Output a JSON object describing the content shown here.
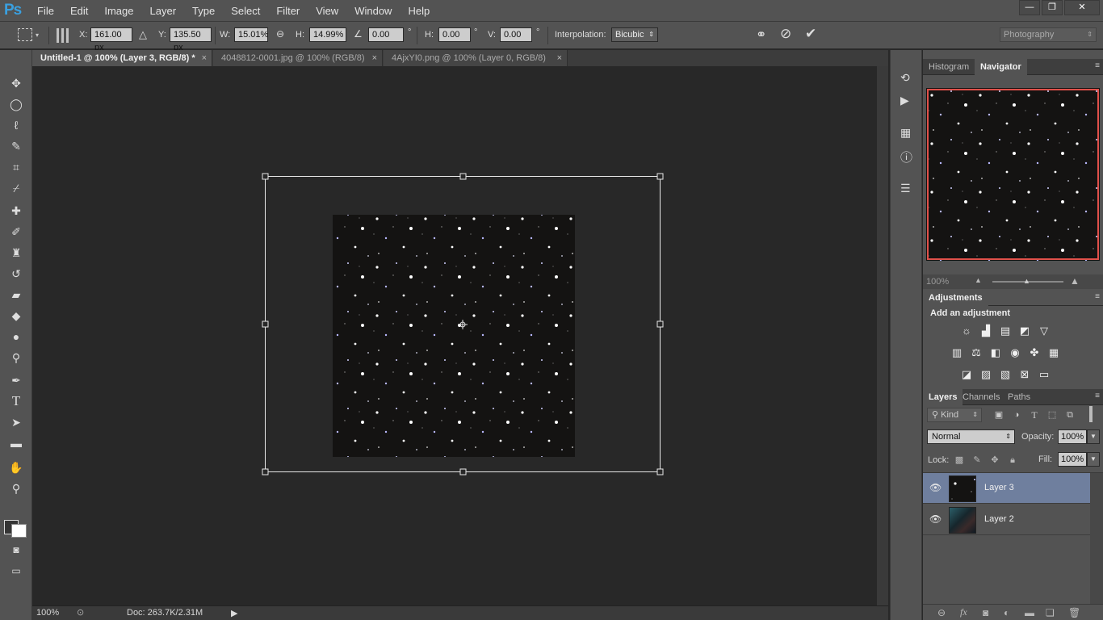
{
  "app": {
    "logo": "Ps"
  },
  "menu": [
    "File",
    "Edit",
    "Image",
    "Layer",
    "Type",
    "Select",
    "Filter",
    "View",
    "Window",
    "Help"
  ],
  "window_controls": {
    "minimize": "—",
    "restore": "❐",
    "close": "✕"
  },
  "options": {
    "x_label": "X:",
    "x_value": "161.00 px",
    "y_label": "Y:",
    "y_value": "135.50 px",
    "w_label": "W:",
    "w_value": "15.01%",
    "h_label": "H:",
    "h_value": "14.99%",
    "angle_value": "0.00",
    "angle_unit": "°",
    "hskew_label": "H:",
    "hskew_value": "0.00",
    "hskew_unit": "°",
    "vskew_label": "V:",
    "vskew_value": "0.00",
    "vskew_unit": "°",
    "interp_label": "Interpolation:",
    "interp_value": "Bicubic",
    "workspace": "Photography"
  },
  "doc_tabs": [
    {
      "label": "Untitled-1 @ 100% (Layer 3, RGB/8) *",
      "close": "×"
    },
    {
      "label": "4048812-0001.jpg @ 100% (RGB/8)",
      "close": "×"
    },
    {
      "label": "4AjxYI0.png @ 100% (Layer 0, RGB/8)",
      "close": "×"
    }
  ],
  "status": {
    "zoom": "100%",
    "doc": "Doc: 263.7K/2.31M"
  },
  "panels": {
    "top_tabs": [
      "Histogram",
      "Navigator"
    ],
    "nav_zoom": "100%",
    "adjustments_title": "Adjustments",
    "add_adjustment": "Add an adjustment",
    "layer_tabs": [
      "Layers",
      "Channels",
      "Paths"
    ],
    "kind_filter": "Kind",
    "blend_mode": "Normal",
    "opacity_label": "Opacity:",
    "opacity_value": "100%",
    "lock_label": "Lock:",
    "fill_label": "Fill:",
    "fill_value": "100%",
    "layers": [
      {
        "name": "Layer 3",
        "selected": true
      },
      {
        "name": "Layer 2",
        "selected": false
      }
    ]
  },
  "colors": {
    "accent": "#3aa0e0",
    "selected_layer": "#6f7f9e",
    "navigator_frame": "#e0504a"
  }
}
